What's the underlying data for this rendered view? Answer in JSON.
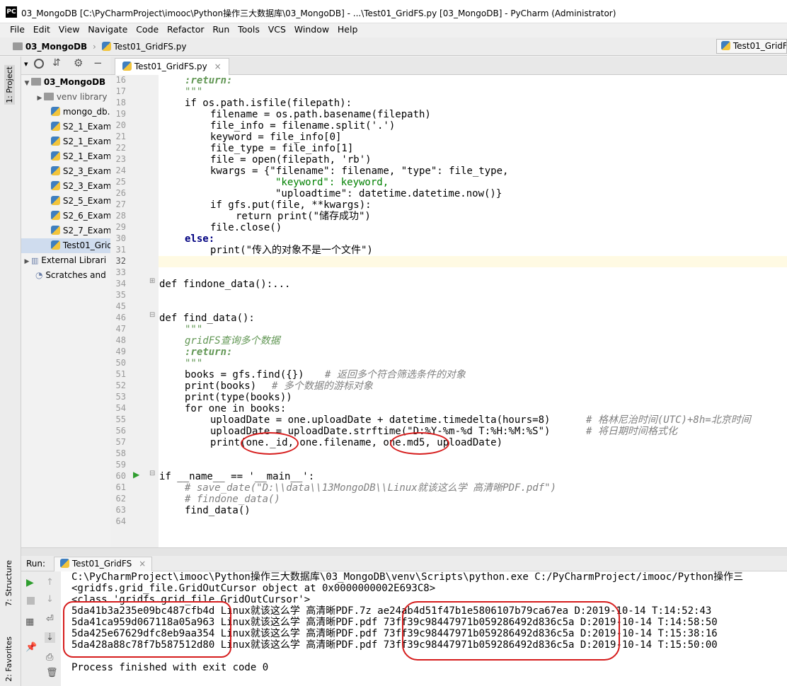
{
  "window": {
    "logo": "PC",
    "title": "03_MongoDB [C:\\PyCharmProject\\imooc\\Python操作三大数据库\\03_MongoDB] - ...\\Test01_GridFS.py [03_MongoDB] - PyCharm (Administrator)"
  },
  "menu": [
    "File",
    "Edit",
    "View",
    "Navigate",
    "Code",
    "Refactor",
    "Run",
    "Tools",
    "VCS",
    "Window",
    "Help"
  ],
  "nav": {
    "project": "03_MongoDB",
    "file": "Test01_GridFS.py",
    "run_config": "Test01_GridF"
  },
  "sidebar_left": {
    "project_label": "1: Project",
    "structure_label": "7: Structure",
    "favorites_label": "2: Favorites"
  },
  "project_tree": [
    {
      "label": "03_MongoDB",
      "kind": "folder",
      "expanded": true
    },
    {
      "label": "venv  library",
      "kind": "folder",
      "expanded": false
    },
    {
      "label": "mongo_db.",
      "kind": "py"
    },
    {
      "label": "S2_1_Examp",
      "kind": "py"
    },
    {
      "label": "S2_1_Examp",
      "kind": "py"
    },
    {
      "label": "S2_1_Examp",
      "kind": "py"
    },
    {
      "label": "S2_3_Examp",
      "kind": "py"
    },
    {
      "label": "S2_3_Examp",
      "kind": "py"
    },
    {
      "label": "S2_5_Examp",
      "kind": "py"
    },
    {
      "label": "S2_6_Examp",
      "kind": "py"
    },
    {
      "label": "S2_7_Examp",
      "kind": "py"
    },
    {
      "label": "Test01_Grid",
      "kind": "py",
      "selected": true
    },
    {
      "label": "External Librari",
      "kind": "lib"
    },
    {
      "label": "Scratches and",
      "kind": "scratch"
    }
  ],
  "editor_tab": "Test01_GridFS.py",
  "line_numbers": [
    "16",
    "17",
    "18",
    "19",
    "20",
    "21",
    "22",
    "23",
    "24",
    "25",
    "26",
    "27",
    "28",
    "29",
    "30",
    "31",
    "32",
    "33",
    "34",
    "35",
    "45",
    "46",
    "47",
    "48",
    "49",
    "50",
    "51",
    "52",
    "53",
    "54",
    "55",
    "56",
    "57",
    "58",
    "59",
    "60",
    "61",
    "62",
    "63",
    "64"
  ],
  "code": {
    "l16": ":return:",
    "l17": "\"\"\"",
    "l18": "if os.path.isfile(filepath):",
    "l19": "filename = os.path.basename(filepath)",
    "l20": "file_info = filename.split('.')",
    "l21": "keyword = file_info[0]",
    "l22": "file_type = file_info[1]",
    "l23": "file = open(filepath, 'rb')",
    "l24": "kwargs = {\"filename\": filename, \"type\": file_type,",
    "l25": "\"keyword\": keyword,",
    "l26": "\"uploadtime\": datetime.datetime.now()}",
    "l27": "if gfs.put(file, **kwargs):",
    "l28": "return print(\"储存成功\")",
    "l29": "file.close()",
    "l30": "else:",
    "l31": "print(\"传入的对象不是一个文件\")",
    "l34": "def findone_data():...",
    "l46": "def find_data():",
    "l47": "\"\"\"",
    "l48": "gridFS查询多个数据",
    "l49": ":return:",
    "l50": "\"\"\"",
    "l51a": "books = gfs.find({})",
    "l51b": "# 返回多个符合筛选条件的对象",
    "l52a": "print(books)",
    "l52b": "# 多个数据的游标对象",
    "l53": "print(type(books))",
    "l54": "for one in books:",
    "l55a": "uploadDate = one.uploadDate + datetime.timedelta(hours=8)",
    "l55b": "# 格林尼治时间(UTC)+8h=北京时间",
    "l56a": "uploadDate = uploadDate.strftime(\"D:%Y-%m-%d T:%H:%M:%S\")",
    "l56b": "# 将日期时间格式化",
    "l57": "print(one._id, one.filename, one.md5, uploadDate)",
    "l60": "if __name__ == '__main__':",
    "l61": "# save_date(\"D:\\\\data\\\\13MongoDB\\\\Linux就该这么学 高清晰PDF.pdf\")",
    "l62": "# findone_data()",
    "l63": "find_data()"
  },
  "run": {
    "label": "Run:",
    "tab": "Test01_GridFS",
    "lines": [
      "C:\\PyCharmProject\\imooc\\Python操作三大数据库\\03_MongoDB\\venv\\Scripts\\python.exe C:/PyCharmProject/imooc/Python操作三",
      "<gridfs.grid_file.GridOutCursor object at 0x0000000002E693C8>",
      "<class 'gridfs.grid_file.GridOutCursor'>",
      "5da41b3a235e09bc487cfb4d Linux就该这么学 高清晰PDF.7z ae24ab4d51f47b1e5806107b79ca67ea D:2019-10-14 T:14:52:43",
      "5da41ca959d067118a05a963 Linux就该这么学 高清晰PDF.pdf 73ff39c98447971b059286492d836c5a D:2019-10-14 T:14:58:50",
      "5da425e67629dfc8eb9aa354 Linux就该这么学 高清晰PDF.pdf 73ff39c98447971b059286492d836c5a D:2019-10-14 T:15:38:16",
      "5da428a88c78f7b587512d80 Linux就该这么学 高清晰PDF.pdf 73ff39c98447971b059286492d836c5a D:2019-10-14 T:15:50:00",
      "",
      "Process finished with exit code 0"
    ]
  },
  "colors": {
    "annotation": "#d61d1d",
    "selection": "#cfdcee",
    "docstring": "#629755",
    "keyword": "#000080",
    "string": "#008000"
  }
}
